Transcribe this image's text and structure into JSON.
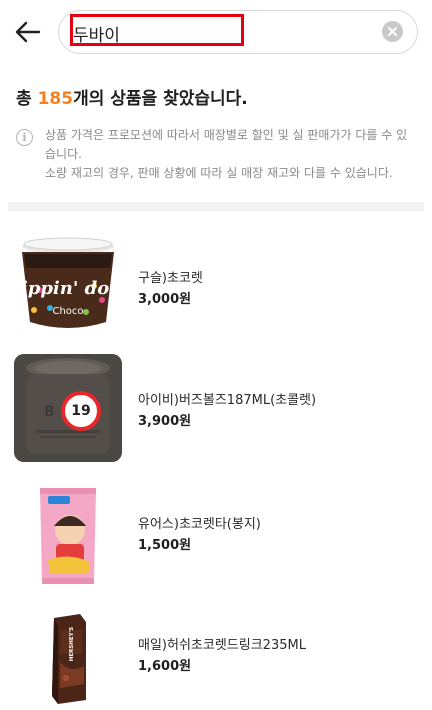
{
  "header": {
    "back_icon": "arrow-left-icon",
    "search_value": "두바이",
    "clear_icon": "close-circle-icon"
  },
  "results": {
    "prefix": "총 ",
    "count": "185",
    "suffix": "개의 상품을 찾았습니다."
  },
  "notice": {
    "icon": "info-icon",
    "line1": "상품 가격은 프로모션에 따라서 매장별로 할인 및 실 판매가가 다를 수 있습니다.",
    "line2": "소량 재고의 경우, 판매 상황에 따라 실 매장 재고와 다를 수 있습니다."
  },
  "products": [
    {
      "name": "구슬)초코렛",
      "price": "3,000원",
      "image_text": "dippin' dots",
      "image_subtext": "Choco"
    },
    {
      "name": "아이비)버즈볼즈187ML(초콜렛)",
      "price": "3,900원",
      "age_badge": "19"
    },
    {
      "name": "유어스)초코렛타(봉지)",
      "price": "1,500원"
    },
    {
      "name": "매일)허쉬초코렛드링크235ML",
      "price": "1,600원",
      "image_text": "HERSHEY'S"
    }
  ],
  "colors": {
    "accent": "#f5821f",
    "highlight": "#e60012",
    "badge_ring": "#e8262b"
  }
}
